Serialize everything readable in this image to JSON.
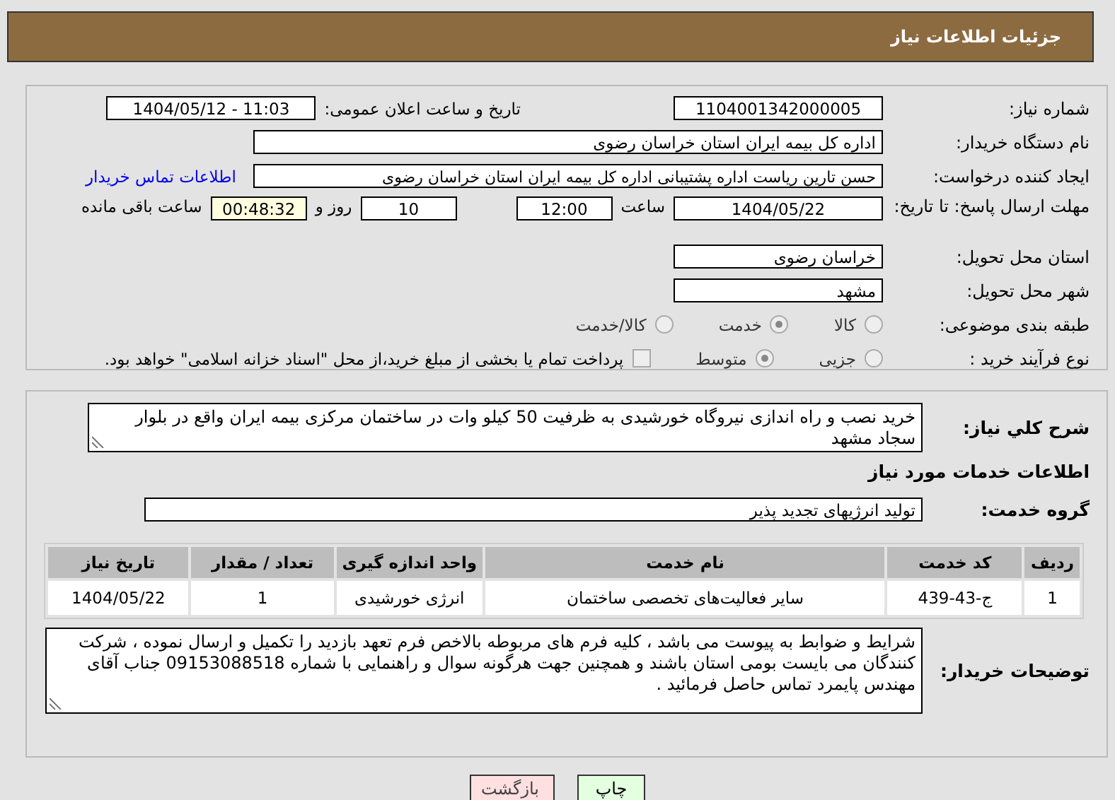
{
  "header": {
    "title": "جزئیات اطلاعات نیاز"
  },
  "need_number": {
    "label": "شماره نیاز:",
    "value": "1104001342000005"
  },
  "announce_date": {
    "label": "تاریخ و ساعت اعلان عمومی:",
    "value": "1404/05/12 - 11:03"
  },
  "buyer": {
    "label": "نام دستگاه خریدار:",
    "value": "اداره کل بیمه ایران استان خراسان رضوی"
  },
  "requester": {
    "label": "ایجاد کننده درخواست:",
    "value": "حسن تارین ریاست اداره پشتیبانی اداره کل بیمه ایران استان خراسان رضوی",
    "link": "اطلاعات تماس خریدار"
  },
  "deadline": {
    "label": "مهلت ارسال پاسخ: تا تاریخ:",
    "date": "1404/05/22",
    "time_label": "ساعت",
    "time": "12:00",
    "days": "10",
    "days_label": "روز و",
    "remaining": "00:48:32",
    "remaining_label": "ساعت باقی مانده"
  },
  "province": {
    "label": "استان محل تحویل:",
    "value": "خراسان رضوی"
  },
  "city": {
    "label": "شهر محل تحویل:",
    "value": "مشهد"
  },
  "category": {
    "label": "طبقه بندی موضوعی:",
    "options": [
      {
        "label": "کالا",
        "selected": false
      },
      {
        "label": "خدمت",
        "selected": true
      },
      {
        "label": "کالا/خدمت",
        "selected": false
      }
    ]
  },
  "process": {
    "label": "نوع فرآیند خرید :",
    "options": [
      {
        "label": "جزیی",
        "selected": false
      },
      {
        "label": "متوسط",
        "selected": true
      }
    ],
    "payment": {
      "checked": false,
      "text": "پرداخت تمام یا بخشی از مبلغ خرید،از محل \"اسناد خزانه اسلامی\" خواهد بود."
    }
  },
  "description": {
    "label": "شرح کلي نياز:",
    "value": "خرید نصب و راه اندازی نیروگاه خورشیدی به ظرفیت 50 کیلو وات در ساختمان مرکزی بیمه ایران واقع در بلوار سجاد مشهد"
  },
  "services_heading": "اطلاعات خدمات مورد نیاز",
  "service_group": {
    "label": "گروه خدمت:",
    "value": "تولید انرژیهای تجدید پذیر"
  },
  "table": {
    "columns": [
      "ردیف",
      "کد خدمت",
      "نام خدمت",
      "واحد اندازه گیری",
      "تعداد / مقدار",
      "تاریخ نیاز"
    ],
    "rows": [
      [
        "1",
        "ج-43-439",
        "سایر فعالیت‌های تخصصی ساختمان",
        "انرژی خورشیدی",
        "1",
        "1404/05/22"
      ]
    ]
  },
  "buyer_notes": {
    "label": "توضیحات خریدار:",
    "value": "شرایط و ضوابط به پیوست می باشد ، کلیه فرم های مربوطه بالاخص فرم تعهد بازدید را تکمیل و ارسال نموده ، شرکت کنندگان می بایست بومی استان باشند و همچنین جهت هرگونه سوال و راهنمایی با شماره 09153088518 جناب آقای مهندس پایمرد تماس حاصل فرمائید ."
  },
  "buttons": [
    {
      "label": "چاپ",
      "kind": "print"
    },
    {
      "label": "بازگشت",
      "kind": "back"
    }
  ]
}
